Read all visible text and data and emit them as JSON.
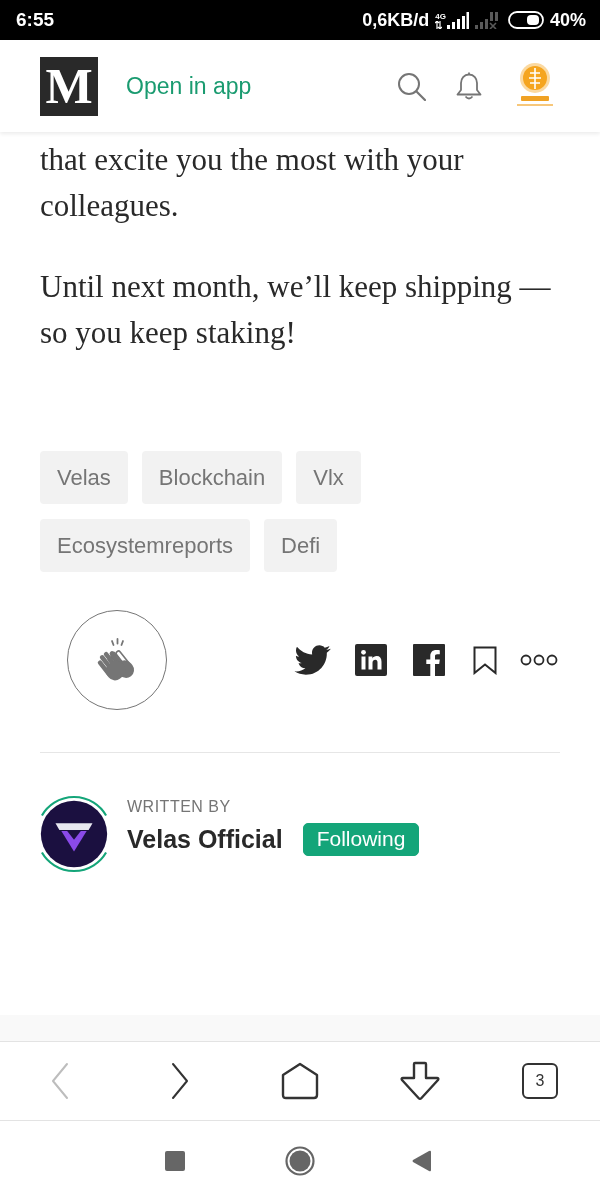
{
  "status_bar": {
    "time": "6:55",
    "data_rate": "0,6KB/d",
    "network": "4G",
    "battery": "40%"
  },
  "header": {
    "logo": "M",
    "open_in_app": "Open in app"
  },
  "article": {
    "paragraphs": [
      "that excite you the most with your colleagues.",
      "Until next month, we’ll keep shipping — so you keep staking!"
    ]
  },
  "tags": [
    "Velas",
    "Blockchain",
    "Vlx",
    "Ecosystemreports",
    "Defi"
  ],
  "author": {
    "label": "WRITTEN BY",
    "name": "Velas Official",
    "follow": {
      "label": "Following",
      "selected": true
    }
  },
  "browser_toolbar": [
    {
      "kind": "back",
      "disabled": true
    },
    {
      "kind": "forward",
      "disabled": false
    },
    {
      "kind": "home",
      "disabled": false
    },
    {
      "kind": "downloads",
      "disabled": false
    },
    {
      "kind": "tabs",
      "disabled": false,
      "count": "3"
    }
  ]
}
